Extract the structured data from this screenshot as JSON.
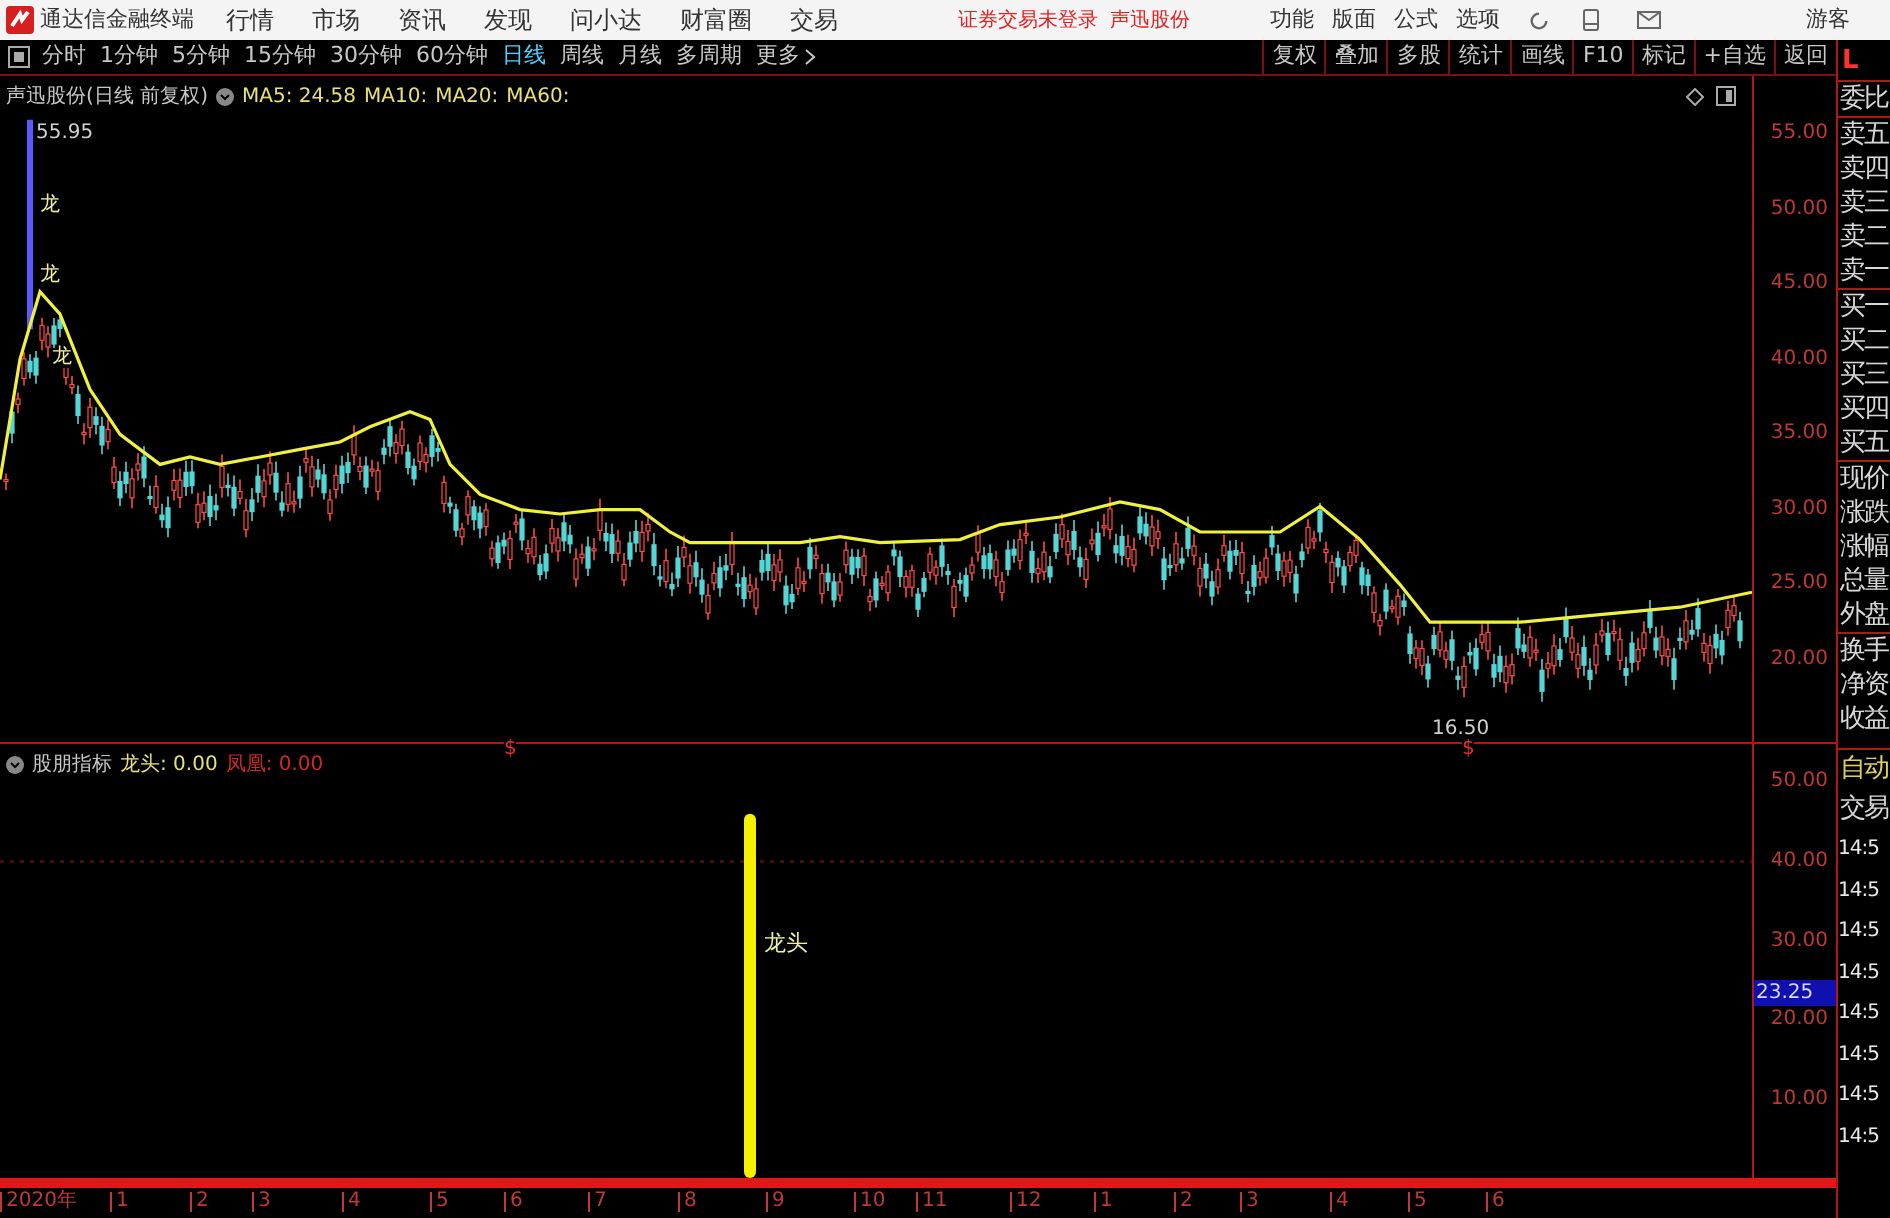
{
  "app": {
    "title": "通达信金融终端"
  },
  "menu": [
    "行情",
    "市场",
    "资讯",
    "发现",
    "问小达",
    "财富圈",
    "交易"
  ],
  "login_status": "证券交易未登录",
  "stock_link": "声迅股份",
  "tools": [
    "功能",
    "版面",
    "公式",
    "选项"
  ],
  "user": "游客",
  "periods": [
    {
      "label": "分时",
      "selected": false
    },
    {
      "label": "1分钟",
      "selected": false
    },
    {
      "label": "5分钟",
      "selected": false
    },
    {
      "label": "15分钟",
      "selected": false
    },
    {
      "label": "30分钟",
      "selected": false
    },
    {
      "label": "60分钟",
      "selected": false
    },
    {
      "label": "日线",
      "selected": true
    },
    {
      "label": "周线",
      "selected": false
    },
    {
      "label": "月线",
      "selected": false
    },
    {
      "label": "多周期",
      "selected": false
    }
  ],
  "more": "更多",
  "actions": [
    "复权",
    "叠加",
    "多股",
    "统计",
    "画线",
    "F10",
    "标记",
    "+自选",
    "返回"
  ],
  "price_chart": {
    "title": "声迅股份(日线 前复权)",
    "ma": [
      "MA5: 24.58",
      "MA10:",
      "MA20:",
      "MA60:"
    ],
    "axis": [
      "55.00",
      "50.00",
      "45.00",
      "40.00",
      "35.00",
      "30.00",
      "25.00",
      "20.00"
    ],
    "annotations": [
      {
        "kind": "high",
        "text": "55.95"
      },
      {
        "kind": "signal",
        "text": "龙"
      },
      {
        "kind": "signal",
        "text": "龙"
      },
      {
        "kind": "signal",
        "text": "龙"
      },
      {
        "kind": "low",
        "text": "16.50"
      },
      {
        "kind": "marker",
        "text": "$"
      },
      {
        "kind": "marker",
        "text": "$"
      }
    ]
  },
  "indicator": {
    "name": "股朋指标",
    "series": [
      {
        "label": "龙头: 0.00",
        "color": "#e8e07a"
      },
      {
        "label": "凤凰: 0.00",
        "color": "#d02828"
      }
    ],
    "axis": [
      "50.00",
      "40.00",
      "30.00",
      "20.00",
      "10.00"
    ],
    "current": "23.25",
    "bar_label": "龙头"
  },
  "time_axis": [
    "2020年",
    "1",
    "2",
    "3",
    "4",
    "5",
    "6",
    "7",
    "8",
    "9",
    "10",
    "11",
    "12",
    "1",
    "2",
    "3",
    "4",
    "5",
    "6"
  ],
  "quote_panel": {
    "header": "L",
    "groups": [
      [
        "委比"
      ],
      [
        "卖五",
        "卖四",
        "卖三",
        "卖二",
        "卖一"
      ],
      [
        "买一",
        "买二",
        "买三",
        "买四",
        "买五"
      ],
      [
        "现价",
        "涨跌",
        "涨幅",
        "总量",
        "外盘"
      ],
      [
        "换手",
        "净资",
        "收益"
      ]
    ],
    "mode": "自动",
    "trade_header": "交易",
    "trades": [
      "14:5",
      "14:5",
      "14:5",
      "14:5",
      "14:5",
      "14:5",
      "14:5",
      "14:5"
    ]
  }
}
